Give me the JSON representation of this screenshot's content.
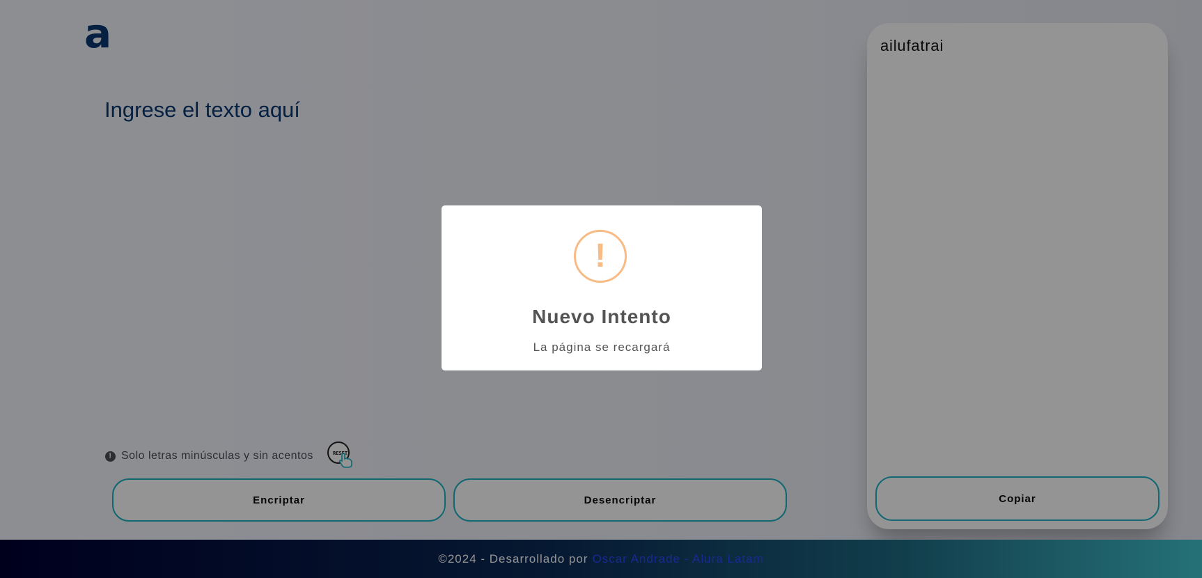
{
  "logo": {
    "text": "a"
  },
  "input": {
    "placeholder": "Ingrese el texto aquí"
  },
  "hint": {
    "text": "Solo letras minúsculas y sin acentos",
    "icon": "info-icon"
  },
  "reset": {
    "label": "RESET"
  },
  "buttons": {
    "encrypt": "Encriptar",
    "decrypt": "Desencriptar",
    "copy": "Copiar"
  },
  "output": {
    "text": "ailufatrai"
  },
  "footer": {
    "prefix": "©2024 - Desarrollado por",
    "author": "Oscar Andrade - Alura Latam"
  },
  "modal": {
    "icon": "!",
    "title": "Nuevo Intento",
    "text": "La página se recargará"
  },
  "colors": {
    "accent": "#1fb4c4",
    "brand": "#0a3871",
    "warning": "#f8bb86"
  }
}
